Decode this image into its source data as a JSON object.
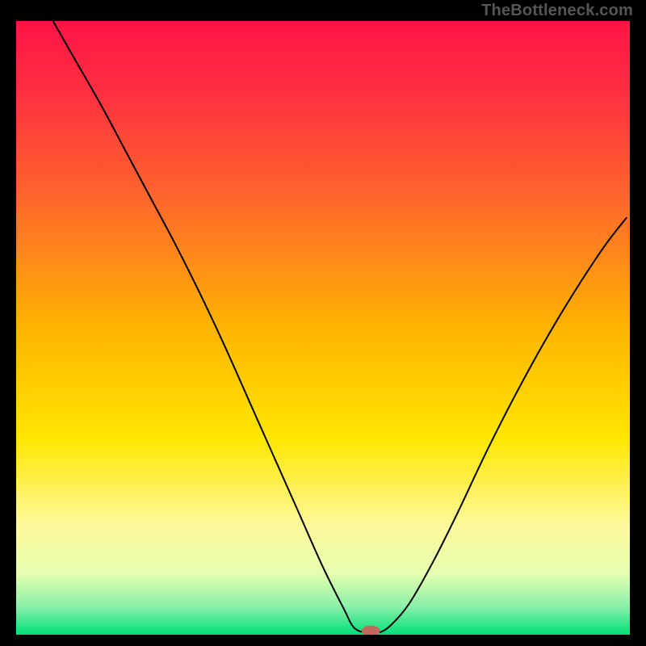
{
  "watermark": "TheBottleneck.com",
  "chart_data": {
    "type": "line",
    "title": "",
    "xlabel": "",
    "ylabel": "",
    "xlim": [
      0,
      100
    ],
    "ylim": [
      0,
      100
    ],
    "grid": false,
    "legend": false,
    "background_gradient_stops": [
      {
        "offset": 0.0,
        "color": "#ff1445"
      },
      {
        "offset": 0.12,
        "color": "#ff3040"
      },
      {
        "offset": 0.3,
        "color": "#ff6a2a"
      },
      {
        "offset": 0.5,
        "color": "#ffb400"
      },
      {
        "offset": 0.68,
        "color": "#ffe600"
      },
      {
        "offset": 0.82,
        "color": "#fff99a"
      },
      {
        "offset": 0.9,
        "color": "#e6ffb0"
      },
      {
        "offset": 0.955,
        "color": "#88f0a8"
      },
      {
        "offset": 1.0,
        "color": "#00e07a"
      }
    ],
    "series": [
      {
        "name": "bottleneck-curve",
        "stroke": "#000000",
        "stroke_width": 2,
        "x": [
          6,
          10,
          14,
          18,
          22,
          26,
          30,
          34,
          38,
          42,
          46,
          50,
          53.5,
          55,
          57,
          59,
          61,
          64,
          68,
          72,
          76,
          80,
          84,
          88,
          92,
          96,
          99.5
        ],
        "y": [
          100,
          93,
          86,
          78.5,
          71,
          63.5,
          55.5,
          47,
          38,
          29,
          20,
          11,
          4,
          1.2,
          0.3,
          0.3,
          1.5,
          5,
          12,
          20,
          28.5,
          36.5,
          44,
          51,
          57.5,
          63.5,
          68
        ]
      }
    ],
    "marker": {
      "name": "optimal-point",
      "x": 57.8,
      "y": 0.6,
      "rx": 1.5,
      "ry": 0.9,
      "fill": "#c46a5a"
    }
  }
}
